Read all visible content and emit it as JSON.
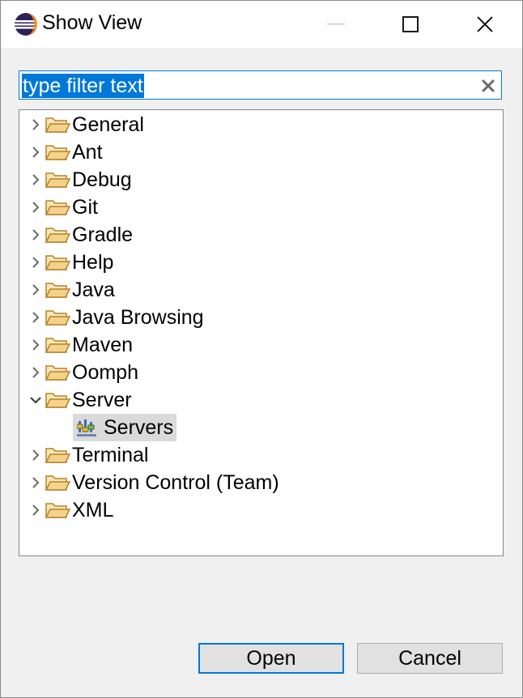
{
  "window": {
    "title": "Show View",
    "icon": "eclipse-icon"
  },
  "filter": {
    "value": "",
    "placeholder": "type filter text",
    "selected_text": "type filter text"
  },
  "tree": {
    "items": [
      {
        "label": "General",
        "expanded": false
      },
      {
        "label": "Ant",
        "expanded": false
      },
      {
        "label": "Debug",
        "expanded": false
      },
      {
        "label": "Git",
        "expanded": false
      },
      {
        "label": "Gradle",
        "expanded": false
      },
      {
        "label": "Help",
        "expanded": false
      },
      {
        "label": "Java",
        "expanded": false
      },
      {
        "label": "Java Browsing",
        "expanded": false
      },
      {
        "label": "Maven",
        "expanded": false
      },
      {
        "label": "Oomph",
        "expanded": false
      },
      {
        "label": "Server",
        "expanded": true,
        "children": [
          {
            "label": "Servers",
            "selected": true,
            "icon": "servers-icon"
          }
        ]
      },
      {
        "label": "Terminal",
        "expanded": false
      },
      {
        "label": "Version Control (Team)",
        "expanded": false
      },
      {
        "label": "XML",
        "expanded": false
      }
    ]
  },
  "buttons": {
    "open": "Open",
    "cancel": "Cancel"
  },
  "colors": {
    "accent": "#0078d7",
    "folder": "#f5d28a",
    "selection": "#dadada"
  }
}
